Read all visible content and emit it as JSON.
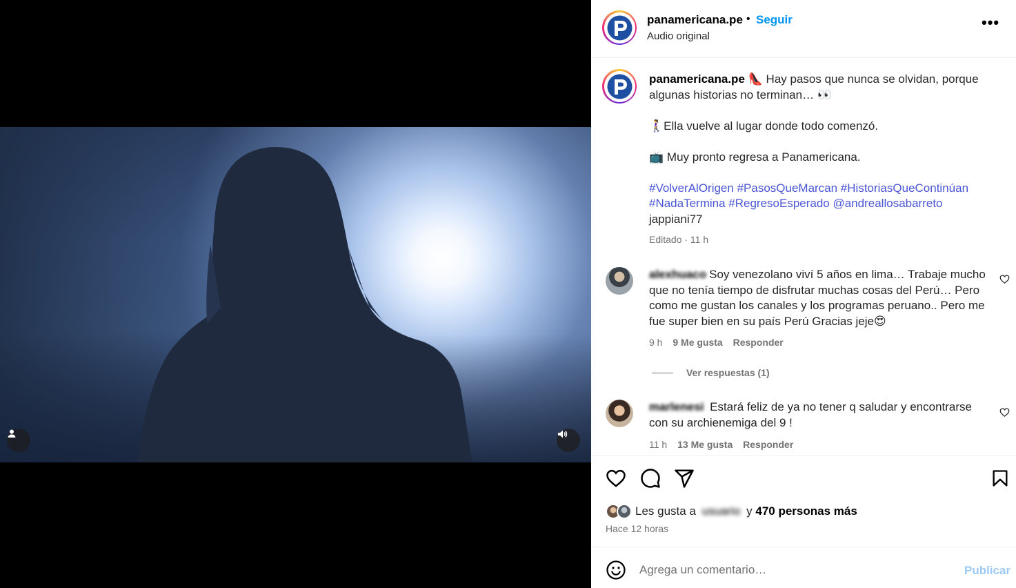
{
  "header": {
    "username": "panamericana.pe",
    "separator": "•",
    "follow_label": "Seguir",
    "audio_label": "Audio original",
    "more_icon": "more-options-icon",
    "more_label": "•••"
  },
  "caption": {
    "username": "panamericana.pe",
    "line1": "Hay pasos que nunca se olvidan, porque algunas historias no terminan…",
    "emoji_shoes": "👠",
    "emoji_eyes": "👀",
    "line2": "Ella vuelve al lugar donde todo comenzó.",
    "emoji_woman": "🚶‍♀️",
    "line3": "Muy pronto regresa a Panamericana.",
    "emoji_tv": "📺",
    "hashtags_line1": "#VolverAlOrigen #PasosQueMarcan #HistoriasQueContinúan",
    "hashtags_line2": "#NadaTermina #RegresoEsperado @andreallosabarreto",
    "mention": "jappiani77",
    "edited": "Editado · 11 h"
  },
  "comments": [
    {
      "username": "alexhuaco",
      "text": "Soy venezolano viví 5 años en lima… Trabaje mucho que no tenía tiempo de disfrutar muchas cosas del Perú… Pero como me gustan los canales y los programas peruano.. Pero me fue super bien en su país Perú Gracias jeje",
      "emoji": "😍",
      "time": "9 h",
      "likes": "9 Me gusta",
      "reply": "Responder"
    },
    {
      "username": "marlenesi",
      "text": "Estará feliz de ya no tener q saludar y encontrarse con su archienemiga del 9 !",
      "time": "11 h",
      "likes": "13 Me gusta",
      "reply": "Responder"
    }
  ],
  "view_replies": "Ver respuestas (1)",
  "likes": {
    "prefix": "Les gusta a",
    "blurred_user": "usuario",
    "middle": "y",
    "rest": "470 personas más",
    "time_ago": "Hace 12 horas"
  },
  "composer": {
    "placeholder": "Agrega un comentario…",
    "publish_label": "Publicar"
  }
}
